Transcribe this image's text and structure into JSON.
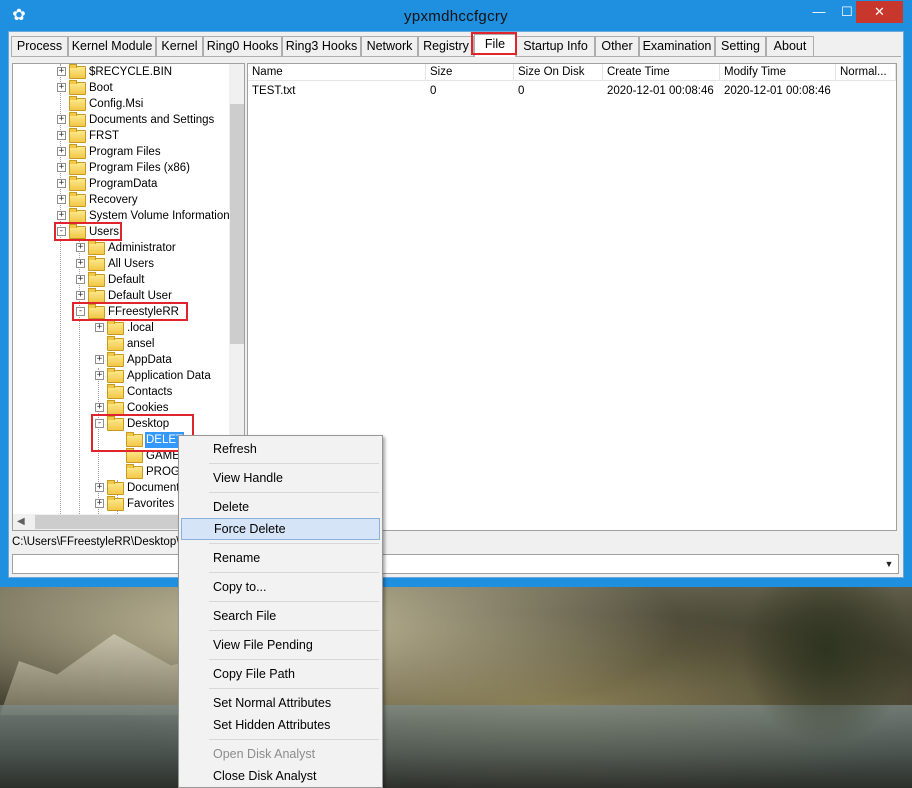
{
  "window": {
    "title": "ypxmdhccfgcry"
  },
  "tabs": [
    {
      "label": "Process"
    },
    {
      "label": "Kernel Module"
    },
    {
      "label": "Kernel"
    },
    {
      "label": "Ring0 Hooks"
    },
    {
      "label": "Ring3 Hooks"
    },
    {
      "label": "Network"
    },
    {
      "label": "Registry"
    },
    {
      "label": "File"
    },
    {
      "label": "Startup Info"
    },
    {
      "label": "Other"
    },
    {
      "label": "Examination"
    },
    {
      "label": "Setting"
    },
    {
      "label": "About"
    }
  ],
  "active_tab": "File",
  "tree": [
    {
      "label": "$RECYCLE.BIN",
      "expander": "+"
    },
    {
      "label": "Boot",
      "expander": "+"
    },
    {
      "label": "Config.Msi",
      "expander": ""
    },
    {
      "label": "Documents and Settings",
      "expander": "+"
    },
    {
      "label": "FRST",
      "expander": "+"
    },
    {
      "label": "Program Files",
      "expander": "+"
    },
    {
      "label": "Program Files (x86)",
      "expander": "+"
    },
    {
      "label": "ProgramData",
      "expander": "+"
    },
    {
      "label": "Recovery",
      "expander": "+"
    },
    {
      "label": "System Volume Information",
      "expander": "+"
    },
    {
      "label": "Users",
      "expander": "-"
    },
    {
      "label": "Administrator",
      "expander": "+"
    },
    {
      "label": "All Users",
      "expander": "+"
    },
    {
      "label": "Default",
      "expander": "+"
    },
    {
      "label": "Default User",
      "expander": "+"
    },
    {
      "label": "FFreestyleRR",
      "expander": "-"
    },
    {
      "label": ".local",
      "expander": "+"
    },
    {
      "label": "ansel",
      "expander": ""
    },
    {
      "label": "AppData",
      "expander": "+"
    },
    {
      "label": "Application Data",
      "expander": "+"
    },
    {
      "label": "Contacts",
      "expander": ""
    },
    {
      "label": "Cookies",
      "expander": "+"
    },
    {
      "label": "Desktop",
      "expander": "-"
    },
    {
      "label": "DELET",
      "expander": "",
      "selected": true
    },
    {
      "label": "GAME",
      "expander": ""
    },
    {
      "label": "PROG",
      "expander": ""
    },
    {
      "label": "Document",
      "expander": "+"
    },
    {
      "label": "Favorites",
      "expander": "+"
    }
  ],
  "file_list": {
    "columns": [
      "Name",
      "Size",
      "Size On Disk",
      "Create Time",
      "Modify Time",
      "Normal..."
    ],
    "rows": [
      [
        "TEST.txt",
        "0",
        "0",
        "2020-12-01 00:08:46",
        "2020-12-01 00:08:46",
        ""
      ]
    ]
  },
  "path_bar": "C:\\Users\\FFreestyleRR\\Desktop\\D",
  "context_menu": [
    {
      "label": "Refresh"
    },
    {
      "label": "View Handle"
    },
    {
      "label": "Delete"
    },
    {
      "label": "Force Delete",
      "hover": true
    },
    {
      "label": "Rename"
    },
    {
      "label": "Copy to..."
    },
    {
      "label": "Search File"
    },
    {
      "label": "View File Pending"
    },
    {
      "label": "Copy File Path"
    },
    {
      "label": "Set Normal Attributes"
    },
    {
      "label": "Set Hidden Attributes"
    },
    {
      "label": "Open Disk Analyst",
      "disabled": true
    },
    {
      "label": "Close Disk Analyst"
    }
  ],
  "colors": {
    "title_bar": "#1f8fe0",
    "close_button": "#c7372b",
    "highlight_box": "#e0242b",
    "selection": "#3399ff",
    "menu_hover": "#d5e4f6"
  }
}
